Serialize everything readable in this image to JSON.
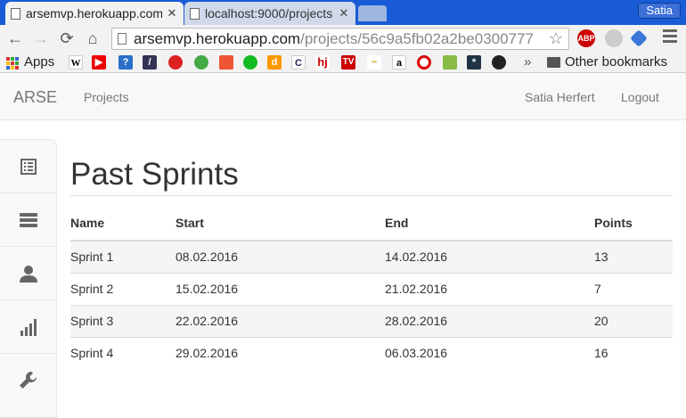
{
  "browser": {
    "tabs": [
      {
        "title": "arsemvp.herokuapp.com",
        "active": true
      },
      {
        "title": "localhost:9000/projects",
        "active": false
      }
    ],
    "profile": "Satia",
    "address": {
      "host": "arsemvp.herokuapp.com",
      "path": "/projects/56c9a5fb02a2be0300777"
    },
    "bookmarks": {
      "apps_label": "Apps",
      "other_label": "Other bookmarks",
      "overflow": "»"
    }
  },
  "app": {
    "brand": "ARSE",
    "nav": {
      "projects": "Projects",
      "user": "Satia Herfert",
      "logout": "Logout"
    },
    "sidebar": [
      {
        "name": "list-icon"
      },
      {
        "name": "stack-icon"
      },
      {
        "name": "user-icon"
      },
      {
        "name": "stats-icon"
      },
      {
        "name": "wrench-icon"
      }
    ],
    "page_title": "Past Sprints",
    "table": {
      "columns": [
        "Name",
        "Start",
        "End",
        "Points"
      ],
      "rows": [
        [
          "Sprint 1",
          "08.02.2016",
          "14.02.2016",
          "13"
        ],
        [
          "Sprint 2",
          "15.02.2016",
          "21.02.2016",
          "7"
        ],
        [
          "Sprint 3",
          "22.02.2016",
          "28.02.2016",
          "20"
        ],
        [
          "Sprint 4",
          "29.02.2016",
          "06.03.2016",
          "16"
        ]
      ]
    }
  },
  "colors": {
    "chrome_frame": "#1a5cd6",
    "navbar_bg": "#f8f8f8",
    "text": "#333333",
    "muted": "#777777"
  }
}
